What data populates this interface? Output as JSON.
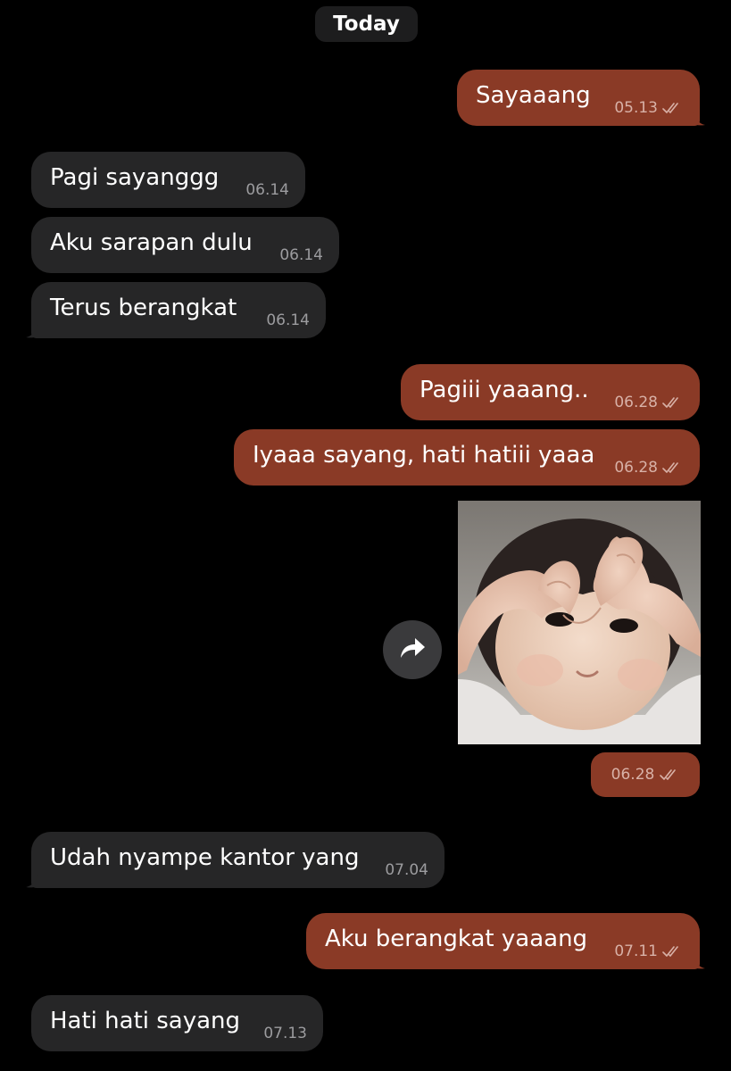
{
  "date_separator": "Today",
  "messages": [
    {
      "direction": "out",
      "text": "Sayaaang",
      "time": "05.13",
      "status": "read"
    },
    {
      "direction": "in",
      "text": "Pagi sayanggg",
      "time": "06.14"
    },
    {
      "direction": "in",
      "text": "Aku sarapan dulu",
      "time": "06.14"
    },
    {
      "direction": "in",
      "text": "Terus berangkat",
      "time": "06.14"
    },
    {
      "direction": "out",
      "text": "Pagiii yaaang..",
      "time": "06.28",
      "status": "read"
    },
    {
      "direction": "out",
      "text": "Iyaaa sayang, hati hatiii yaaa",
      "time": "06.28",
      "status": "read"
    },
    {
      "direction": "out",
      "type": "photo",
      "alt": "baby making heart shape with hands",
      "time": "06.28",
      "status": "read"
    },
    {
      "direction": "in",
      "text": "Udah nyampe kantor yang",
      "time": "07.04"
    },
    {
      "direction": "out",
      "text": "Aku berangkat yaaang",
      "time": "07.11",
      "status": "read"
    },
    {
      "direction": "in",
      "text": "Hati hati sayang",
      "time": "07.13"
    }
  ],
  "icons": {
    "read_receipt": "double-check-icon",
    "share": "share-arrow-icon"
  },
  "colors": {
    "background": "#000000",
    "incoming_bubble": "#262627",
    "outgoing_bubble": "#8a3a26",
    "date_chip": "#1d1d1e"
  }
}
